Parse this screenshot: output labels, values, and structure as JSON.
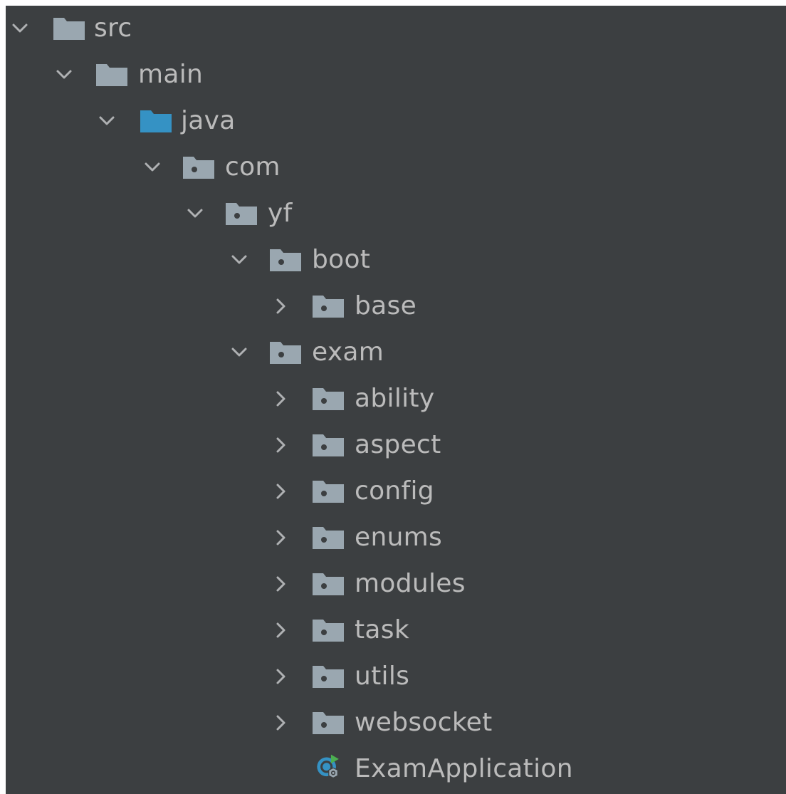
{
  "project_tree": {
    "root": {
      "label": "src",
      "expanded": true,
      "icon": "folder-icon"
    },
    "main": {
      "label": "main",
      "expanded": true,
      "icon": "folder-icon"
    },
    "java": {
      "label": "java",
      "expanded": true,
      "icon": "source-root-folder-icon",
      "color": "#3592c4"
    },
    "com": {
      "label": "com",
      "expanded": true,
      "icon": "package-icon"
    },
    "yf": {
      "label": "yf",
      "expanded": true,
      "icon": "package-icon"
    },
    "boot": {
      "label": "boot",
      "expanded": true,
      "icon": "package-icon"
    },
    "base": {
      "label": "base",
      "expanded": false,
      "icon": "package-icon"
    },
    "exam": {
      "label": "exam",
      "expanded": true,
      "icon": "package-icon"
    },
    "exam_children": [
      {
        "label": "ability",
        "expanded": false,
        "icon": "package-icon"
      },
      {
        "label": "aspect",
        "expanded": false,
        "icon": "package-icon"
      },
      {
        "label": "config",
        "expanded": false,
        "icon": "package-icon"
      },
      {
        "label": "enums",
        "expanded": false,
        "icon": "package-icon"
      },
      {
        "label": "modules",
        "expanded": false,
        "icon": "package-icon"
      },
      {
        "label": "task",
        "expanded": false,
        "icon": "package-icon"
      },
      {
        "label": "utils",
        "expanded": false,
        "icon": "package-icon"
      },
      {
        "label": "websocket",
        "expanded": false,
        "icon": "package-icon"
      }
    ],
    "application_class": {
      "label": "ExamApplication",
      "icon": "spring-boot-run-class-icon"
    }
  },
  "colors": {
    "background": "#3c3f41",
    "text": "#bbbbbb",
    "folder": "#9aa7b0",
    "source_root": "#3592c4",
    "arrow": "#afb1b3"
  }
}
